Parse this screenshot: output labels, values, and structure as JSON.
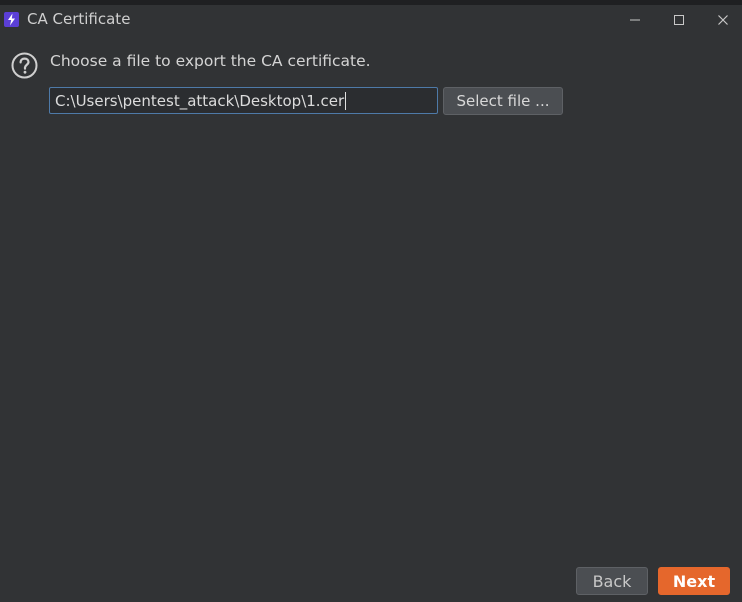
{
  "window": {
    "title": "CA Certificate",
    "app_icon": "lightning-icon",
    "controls": [
      "minimize-icon",
      "maximize-icon",
      "close-icon"
    ]
  },
  "main": {
    "help_icon": "question-icon",
    "prompt": "Choose a file to export the CA certificate.",
    "file_path": "C:\\Users\\pentest_attack\\Desktop\\1.cer",
    "select_file_label": "Select file ..."
  },
  "footer": {
    "back_label": "Back",
    "next_label": "Next"
  },
  "colors": {
    "background": "#313335",
    "accent": "#e5672c",
    "input_focus_border": "#4e7aa8",
    "app_icon_bg": "#5b3fd6"
  }
}
